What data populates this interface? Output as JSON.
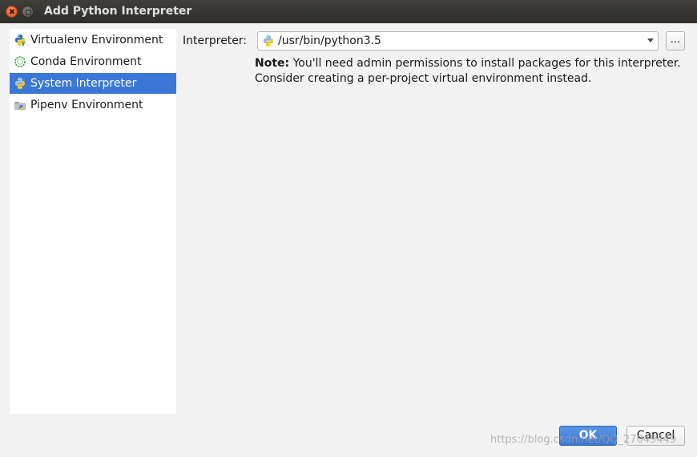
{
  "window": {
    "title": "Add Python Interpreter"
  },
  "sidebar": {
    "items": [
      {
        "label": "Virtualenv Environment",
        "icon": "python-virtualenv-icon",
        "selected": false
      },
      {
        "label": "Conda Environment",
        "icon": "conda-icon",
        "selected": false
      },
      {
        "label": "System Interpreter",
        "icon": "python-icon",
        "selected": true
      },
      {
        "label": "Pipenv Environment",
        "icon": "pipenv-icon",
        "selected": false
      }
    ]
  },
  "main": {
    "interpreter_label": "Interpreter:",
    "interpreter_value": "/usr/bin/python3.5",
    "browse_label": "...",
    "note_bold": "Note:",
    "note_line1": "You'll need admin permissions to install packages for this interpreter.",
    "note_line2": "Consider creating a per-project virtual environment instead."
  },
  "footer": {
    "ok_label": "OK",
    "cancel_label": "Cancel",
    "watermark": "https://blog.csdn.net/QQ_27049449"
  },
  "colors": {
    "selection": "#3a77d6",
    "titlebar": "#34332f",
    "background": "#f2f2f2"
  }
}
